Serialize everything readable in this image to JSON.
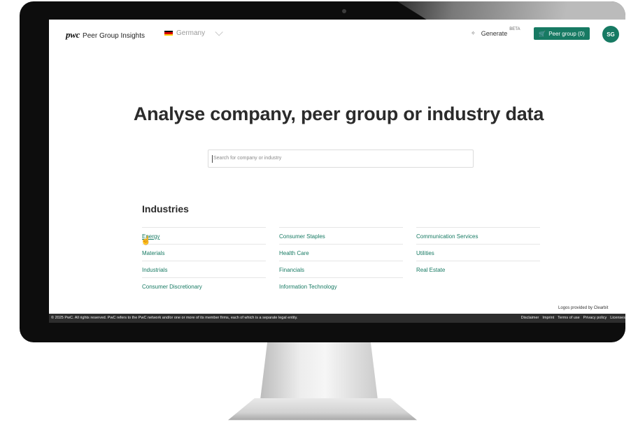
{
  "header": {
    "brand_logo": "pwc",
    "brand_name": "Peer Group Insights",
    "country": "Germany",
    "generate_label": "Generate",
    "generate_badge": "BETA",
    "peer_group_label": "Peer group (0)",
    "avatar_initials": "SG"
  },
  "main": {
    "title": "Analyse company, peer group or industry data",
    "search_placeholder": "Search for company or industry"
  },
  "industries": {
    "heading": "Industries",
    "items": [
      "Energy",
      "Consumer Staples",
      "Communication Services",
      "Materials",
      "Health Care",
      "Utilities",
      "Industrials",
      "Financials",
      "Real Estate",
      "Consumer Discretionary",
      "Information Technology"
    ]
  },
  "footer": {
    "logos_credit": "Logos provided by Clearbit",
    "copyright": "© 2025 PwC. All rights reserved. PwC refers to the PwC network and/or one or more of its member firms, each of which is a separate legal entity.",
    "links": [
      "Disclaimer",
      "Imprint",
      "Terms of use",
      "Privacy policy",
      "Licenses"
    ]
  },
  "colors": {
    "accent": "#177a63",
    "flag": [
      "#000000",
      "#dd0000",
      "#ffce00"
    ]
  },
  "icons": [
    "sparkle-icon",
    "cart-icon",
    "chevron-down-icon",
    "hand-cursor-icon",
    "flag-de-icon"
  ]
}
